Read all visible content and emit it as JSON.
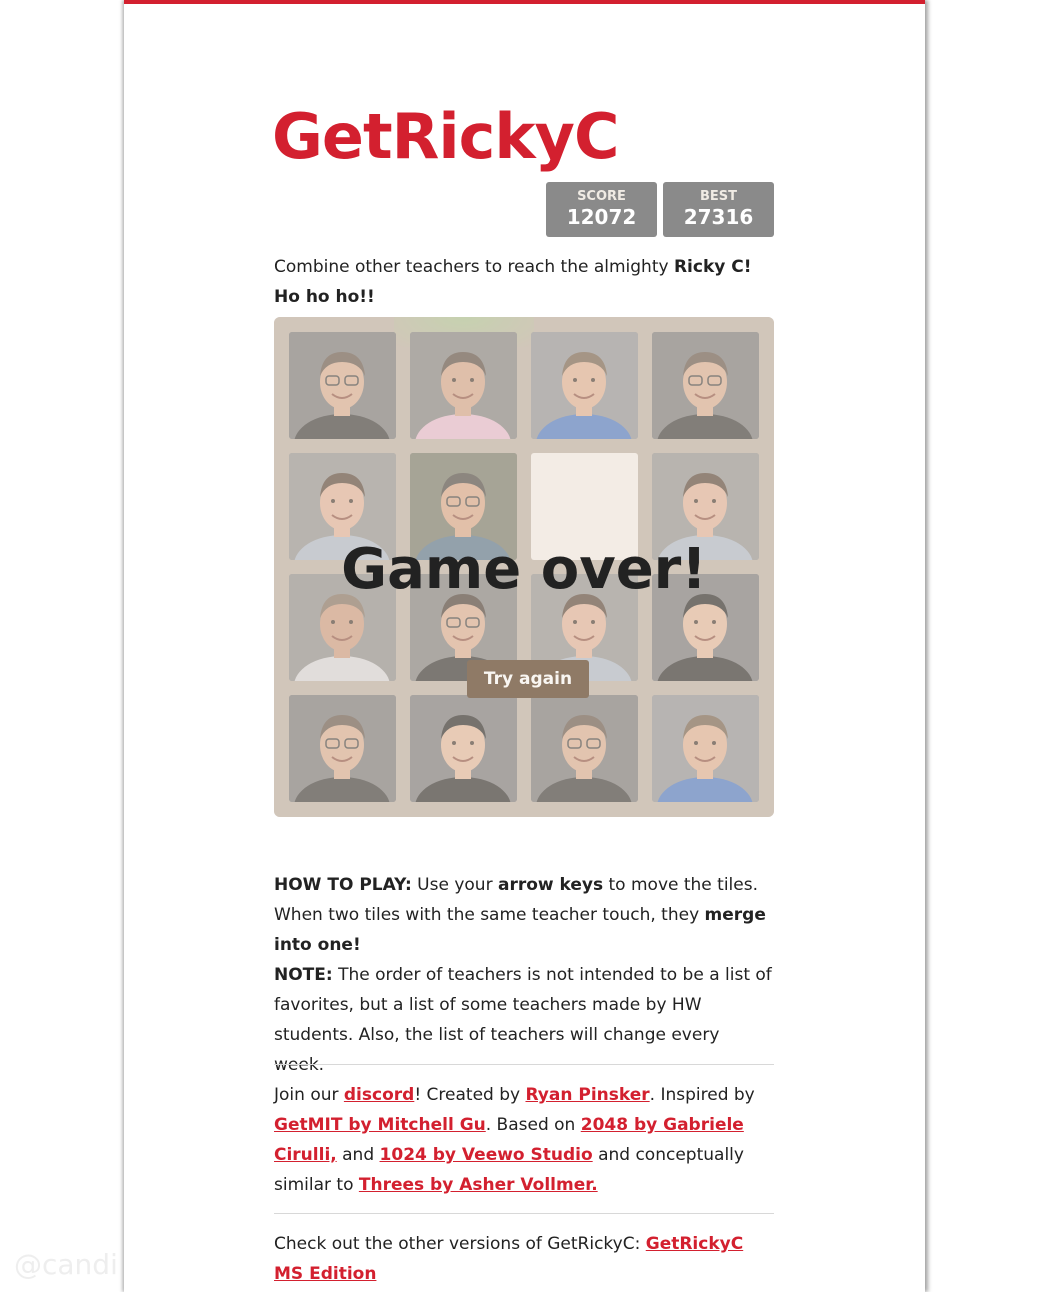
{
  "title": "GetRickyC",
  "scores": {
    "score_label": "SCORE",
    "score_value": "12072",
    "best_label": "BEST",
    "best_value": "27316"
  },
  "intro": {
    "text": "Combine other teachers to reach the almighty ",
    "bold": "Ricky C! Ho ho ho!!"
  },
  "board": {
    "rows": [
      [
        "teacher-a",
        "teacher-b",
        "teacher-c",
        "teacher-a"
      ],
      [
        "teacher-d",
        "teacher-e",
        "empty",
        "teacher-d"
      ],
      [
        "teacher-f",
        "teacher-g",
        "teacher-d",
        "teacher-h"
      ],
      [
        "teacher-a",
        "teacher-h",
        "teacher-a",
        "teacher-c"
      ]
    ],
    "game_over_text": "Game over!",
    "try_again_label": "Try again"
  },
  "howto": {
    "label": "HOW TO PLAY:",
    "text1": " Use your ",
    "bold1": "arrow keys",
    "text2": " to move the tiles. When two tiles with the same teacher touch, they ",
    "bold2": "merge into one!",
    "note_label": "NOTE:",
    "note_text": " The order of teachers is not intended to be a list of favorites, but a list of some teachers made by HW students. Also, the list of teachers will change every week."
  },
  "credits": {
    "t1": "Join our ",
    "discord": "discord",
    "t2": "! Created by ",
    "creator": "Ryan Pinsker",
    "t3": ". Inspired by ",
    "getmit": "GetMIT by Mitchell Gu",
    "t4": ". Based on ",
    "game2048": "2048 by Gabriele Cirulli,",
    "t5": " and ",
    "game1024": "1024 by Veewo Studio",
    "t6": " and conceptually similar to ",
    "threes": "Threes by Asher Vollmer."
  },
  "versions": {
    "text": "Check out the other versions of GetRickyC: ",
    "link": "GetRickyC MS Edition"
  },
  "watermark": "@candi",
  "colors": {
    "accent": "#d3202f",
    "board": "#bbada0",
    "score_box": "#8a8a8a",
    "button": "#8f7a66"
  }
}
